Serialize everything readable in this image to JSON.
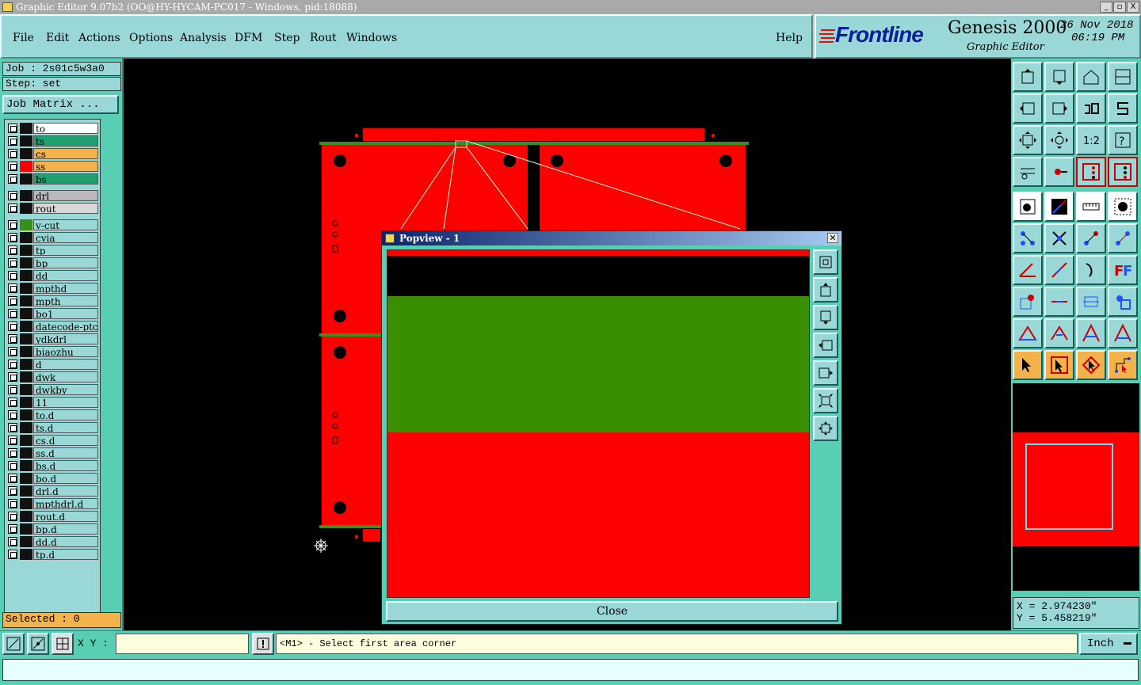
{
  "window": {
    "title": "Graphic Editor 9.07b2 (OO@HY-HYCAM-PC017 - Windows, pid:18088)",
    "minimize": "_",
    "maximize": "▫",
    "close": "X"
  },
  "menu": {
    "items": [
      "File",
      "Edit",
      "Actions",
      "Options",
      "Analysis",
      "DFM",
      "Step",
      "Rout",
      "Windows"
    ],
    "help": "Help"
  },
  "brand": {
    "logo": "Frontline",
    "product": "Genesis 2000",
    "subtitle": "Graphic Editor",
    "date": "26 Nov 2018",
    "time": "06:19 PM"
  },
  "left": {
    "job": "Job : 2s01c5w3a0",
    "step": "Step: set",
    "job_matrix": "Job Matrix ...",
    "selected": "Selected : 0",
    "layers_group1": [
      {
        "name": "to",
        "color": "#ffffff",
        "swatch": "#111111"
      },
      {
        "name": "ts",
        "color": "#1fa06e",
        "swatch": "#111111"
      },
      {
        "name": "cs",
        "color": "#f4b24a",
        "swatch": "#111111"
      },
      {
        "name": "ss",
        "color": "#f4b24a",
        "swatch": "#ff0000"
      },
      {
        "name": "bs",
        "color": "#1fa06e",
        "swatch": "#111111"
      }
    ],
    "layers_group2": [
      {
        "name": "drl",
        "color": "#b9b9b9",
        "swatch": "#111111"
      },
      {
        "name": "rout",
        "color": "#d8d8d8",
        "swatch": "#111111"
      }
    ],
    "layers_group3": [
      {
        "name": "v-cut",
        "color": "#9ad8d8",
        "swatch": "#3a8f1a"
      },
      {
        "name": "cvia",
        "color": "#9ad8d8",
        "swatch": "#111111"
      },
      {
        "name": "tp",
        "color": "#9ad8d8",
        "swatch": "#111111"
      },
      {
        "name": "bp",
        "color": "#9ad8d8",
        "swatch": "#111111"
      },
      {
        "name": "dd",
        "color": "#9ad8d8",
        "swatch": "#111111"
      },
      {
        "name": "mpthd",
        "color": "#9ad8d8",
        "swatch": "#111111"
      },
      {
        "name": "mpth",
        "color": "#9ad8d8",
        "swatch": "#111111"
      },
      {
        "name": "bo1",
        "color": "#9ad8d8",
        "swatch": "#111111"
      },
      {
        "name": "datecode-ptc",
        "color": "#9ad8d8",
        "swatch": "#111111"
      },
      {
        "name": "ydkdrl",
        "color": "#9ad8d8",
        "swatch": "#111111"
      },
      {
        "name": "biaozhu",
        "color": "#9ad8d8",
        "swatch": "#111111"
      },
      {
        "name": "d",
        "color": "#9ad8d8",
        "swatch": "#111111"
      },
      {
        "name": "dwk",
        "color": "#9ad8d8",
        "swatch": "#111111"
      },
      {
        "name": "dwkby",
        "color": "#9ad8d8",
        "swatch": "#111111"
      },
      {
        "name": "11",
        "color": "#9ad8d8",
        "swatch": "#111111"
      },
      {
        "name": "to.d",
        "color": "#9ad8d8",
        "swatch": "#111111"
      },
      {
        "name": "ts.d",
        "color": "#9ad8d8",
        "swatch": "#111111"
      },
      {
        "name": "cs.d",
        "color": "#9ad8d8",
        "swatch": "#111111"
      },
      {
        "name": "ss.d",
        "color": "#9ad8d8",
        "swatch": "#111111"
      },
      {
        "name": "bs.d",
        "color": "#9ad8d8",
        "swatch": "#111111"
      },
      {
        "name": "bo.d",
        "color": "#9ad8d8",
        "swatch": "#111111"
      },
      {
        "name": "drl.d",
        "color": "#9ad8d8",
        "swatch": "#111111"
      },
      {
        "name": "mpthdrl.d",
        "color": "#9ad8d8",
        "swatch": "#111111"
      },
      {
        "name": "rout.d",
        "color": "#9ad8d8",
        "swatch": "#111111"
      },
      {
        "name": "bp.d",
        "color": "#9ad8d8",
        "swatch": "#111111"
      },
      {
        "name": "dd.d",
        "color": "#9ad8d8",
        "swatch": "#111111"
      },
      {
        "name": "tp.d",
        "color": "#9ad8d8",
        "swatch": "#111111"
      }
    ]
  },
  "popview": {
    "title": "Popview - 1",
    "close_label": "Close"
  },
  "coords": {
    "x": "X = 2.974230\"",
    "y": "Y = 5.458219\""
  },
  "bottom": {
    "xy_label": "X Y :",
    "xy_value": "",
    "prompt": "<M1> - Select first area corner",
    "units": "Inch"
  },
  "colors": {
    "panel": "#58ceb4",
    "button": "#9ad8d8",
    "copper": "#ff0000",
    "vcut": "#3a8f1a"
  }
}
